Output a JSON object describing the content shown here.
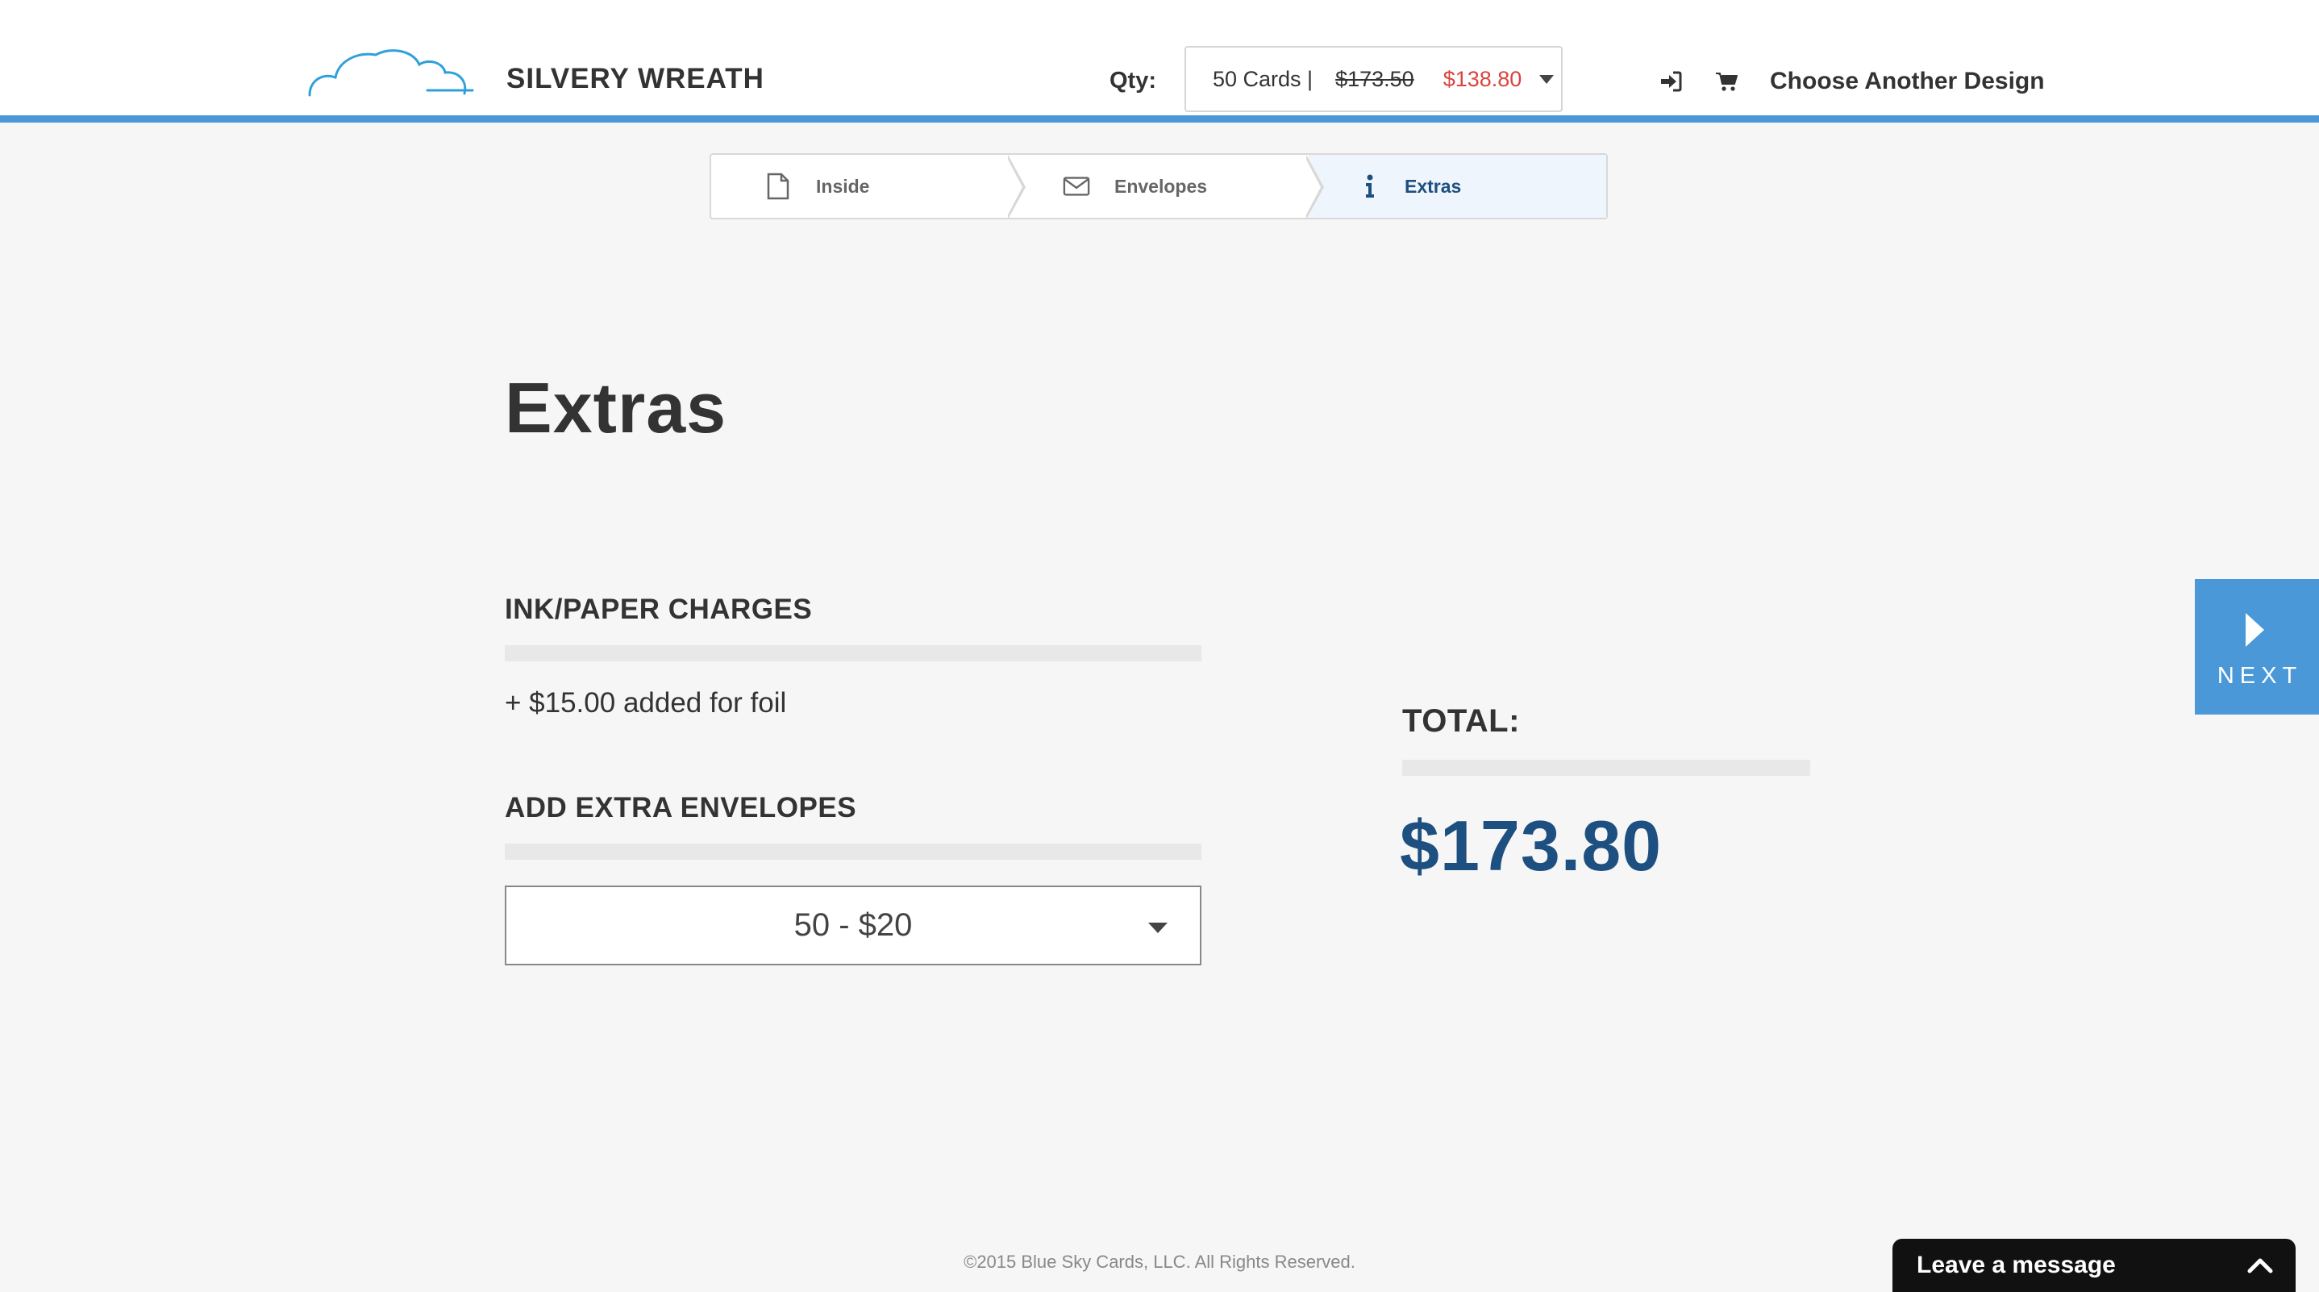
{
  "header": {
    "design_name": "SILVERY WREATH",
    "qty_label": "Qty:",
    "qty_select": {
      "cards": "50 Cards |",
      "old_price": "$173.50",
      "new_price": "$138.80"
    },
    "choose_another": "Choose Another Design",
    "icons": {
      "logo": "cloud-logo-icon",
      "login": "sign-in-icon",
      "cart": "cart-icon"
    },
    "accent_color": "#4a98d8"
  },
  "steps": [
    {
      "label": "Inside",
      "icon": "document-icon",
      "active": false
    },
    {
      "label": "Envelopes",
      "icon": "envelope-icon",
      "active": false
    },
    {
      "label": "Extras",
      "icon": "info-icon",
      "active": true
    }
  ],
  "main": {
    "title": "Extras",
    "ink_paper": {
      "heading": "INK/PAPER CHARGES",
      "text": "+ $15.00 added for foil"
    },
    "envelopes": {
      "heading": "ADD EXTRA ENVELOPES",
      "selected": "50 - $20"
    },
    "total": {
      "label": "TOTAL:",
      "value": "$173.80",
      "color": "#1d4f80"
    }
  },
  "next_button": {
    "label": "NEXT"
  },
  "footer": {
    "copyright": "©2015 Blue Sky Cards, LLC. All Rights Reserved."
  },
  "chat": {
    "label": "Leave a message"
  }
}
